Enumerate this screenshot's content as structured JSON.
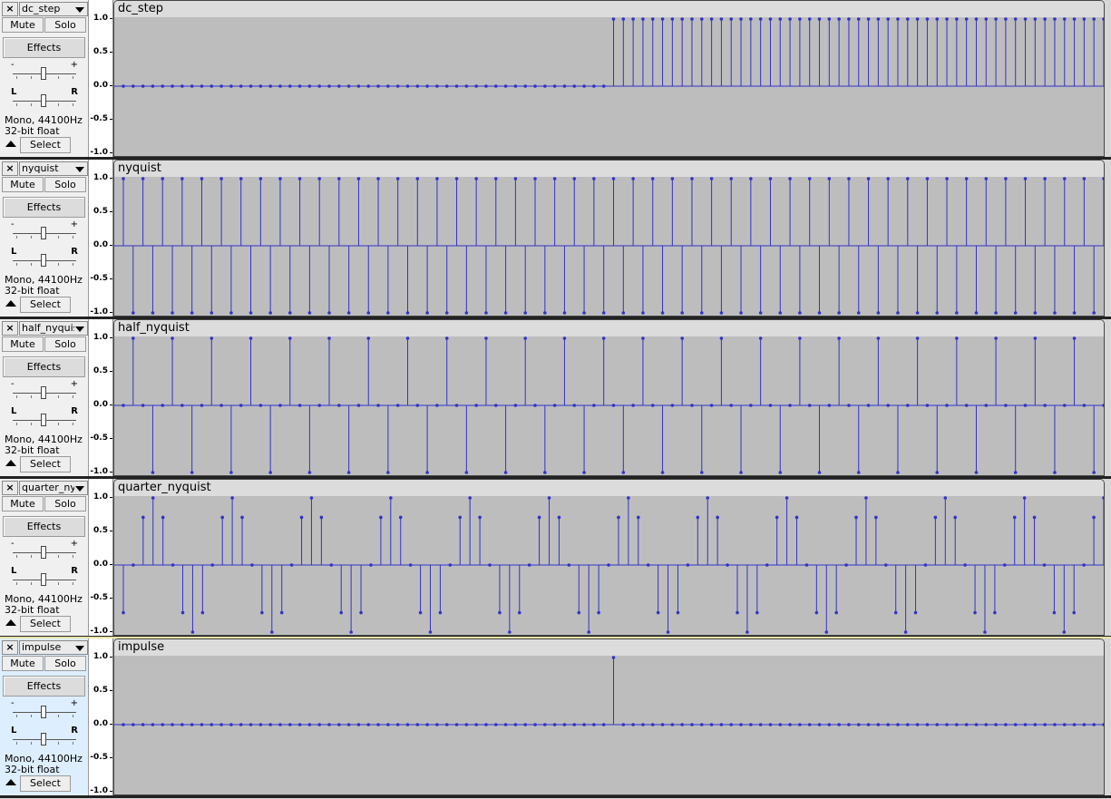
{
  "controls": {
    "close_glyph": "×",
    "mute_label": "Mute",
    "solo_label": "Solo",
    "effects_label": "Effects",
    "select_label": "Select",
    "gain_minus": "-",
    "gain_plus": "+",
    "pan_left": "L",
    "pan_right": "R"
  },
  "colors": {
    "waveform": "#3232c8",
    "background": "#bdbdbd",
    "selected_panel": "#ddeeff"
  },
  "icons": [
    "close-icon",
    "dropdown-chevron-icon",
    "collapse-arrow-icon"
  ],
  "ruler_ticks": [
    "1.0",
    "0.5",
    "0.0",
    "-0.5",
    "-1.0"
  ],
  "tracks": [
    {
      "name": "dc_step",
      "label": "dc_step",
      "format": "Mono, 44100Hz",
      "bit_depth": "32-bit float",
      "selected": false,
      "chart_data": {
        "type": "line",
        "ylim": [
          -1.0,
          1.0
        ],
        "samples": [
          0,
          0,
          0,
          0,
          0,
          0,
          0,
          0,
          0,
          0,
          0,
          0,
          0,
          0,
          0,
          0,
          0,
          0,
          0,
          0,
          0,
          0,
          0,
          0,
          0,
          0,
          0,
          0,
          0,
          0,
          0,
          0,
          0,
          0,
          0,
          0,
          0,
          0,
          0,
          0,
          0,
          0,
          0,
          0,
          0,
          0,
          0,
          0,
          0,
          0,
          1,
          1,
          1,
          1,
          1,
          1,
          1,
          1,
          1,
          1,
          1,
          1,
          1,
          1,
          1,
          1,
          1,
          1,
          1,
          1,
          1,
          1,
          1,
          1,
          1,
          1,
          1,
          1,
          1,
          1,
          1,
          1,
          1,
          1,
          1,
          1,
          1,
          1,
          1,
          1,
          1,
          1,
          1,
          1,
          1,
          1,
          1,
          1,
          1,
          1,
          1
        ]
      }
    },
    {
      "name": "nyquist",
      "label": "nyquist",
      "format": "Mono, 44100Hz",
      "bit_depth": "32-bit float",
      "selected": false,
      "chart_data": {
        "type": "line",
        "ylim": [
          -1.0,
          1.0
        ],
        "samples": [
          1,
          -1,
          1,
          -1,
          1,
          -1,
          1,
          -1,
          1,
          -1,
          1,
          -1,
          1,
          -1,
          1,
          -1,
          1,
          -1,
          1,
          -1,
          1,
          -1,
          1,
          -1,
          1,
          -1,
          1,
          -1,
          1,
          -1,
          1,
          -1,
          1,
          -1,
          1,
          -1,
          1,
          -1,
          1,
          -1,
          1,
          -1,
          1,
          -1,
          1,
          -1,
          1,
          -1,
          1,
          -1,
          1,
          -1,
          1,
          -1,
          1,
          -1,
          1,
          -1,
          1,
          -1,
          1,
          -1,
          1,
          -1,
          1,
          -1,
          1,
          -1,
          1,
          -1,
          1,
          -1,
          1,
          -1,
          1,
          -1,
          1,
          -1,
          1,
          -1,
          1,
          -1,
          1,
          -1,
          1,
          -1,
          1,
          -1,
          1,
          -1,
          1,
          -1,
          1,
          -1,
          1,
          -1,
          1,
          -1,
          1,
          -1,
          1
        ]
      }
    },
    {
      "name": "half_nyquist",
      "label": "half_nyquist",
      "format": "Mono, 44100Hz",
      "bit_depth": "32-bit float",
      "selected": false,
      "chart_data": {
        "type": "line",
        "ylim": [
          -1.0,
          1.0
        ],
        "samples": [
          0,
          1,
          0,
          -1,
          0,
          1,
          0,
          -1,
          0,
          1,
          0,
          -1,
          0,
          1,
          0,
          -1,
          0,
          1,
          0,
          -1,
          0,
          1,
          0,
          -1,
          0,
          1,
          0,
          -1,
          0,
          1,
          0,
          -1,
          0,
          1,
          0,
          -1,
          0,
          1,
          0,
          -1,
          0,
          1,
          0,
          -1,
          0,
          1,
          0,
          -1,
          0,
          1,
          0,
          -1,
          0,
          1,
          0,
          -1,
          0,
          1,
          0,
          -1,
          0,
          1,
          0,
          -1,
          0,
          1,
          0,
          -1,
          0,
          1,
          0,
          -1,
          0,
          1,
          0,
          -1,
          0,
          1,
          0,
          -1,
          0,
          1,
          0,
          -1,
          0,
          1,
          0,
          -1,
          0,
          1,
          0,
          -1,
          0,
          1,
          0,
          -1,
          0,
          1,
          0,
          -1,
          0
        ]
      }
    },
    {
      "name": "quarter_nyquist",
      "label": "quarter_nyquist",
      "format": "Mono, 44100Hz",
      "bit_depth": "32-bit float",
      "selected": false,
      "chart_data": {
        "type": "line",
        "ylim": [
          -1.0,
          1.0
        ],
        "samples": [
          -0.71,
          0,
          0.71,
          1,
          0.71,
          0,
          -0.71,
          -1,
          -0.71,
          0,
          0.71,
          1,
          0.71,
          0,
          -0.71,
          -1,
          -0.71,
          0,
          0.71,
          1,
          0.71,
          0,
          -0.71,
          -1,
          -0.71,
          0,
          0.71,
          1,
          0.71,
          0,
          -0.71,
          -1,
          -0.71,
          0,
          0.71,
          1,
          0.71,
          0,
          -0.71,
          -1,
          -0.71,
          0,
          0.71,
          1,
          0.71,
          0,
          -0.71,
          -1,
          -0.71,
          0,
          0.71,
          1,
          0.71,
          0,
          -0.71,
          -1,
          -0.71,
          0,
          0.71,
          1,
          0.71,
          0,
          -0.71,
          -1,
          -0.71,
          0,
          0.71,
          1,
          0.71,
          0,
          -0.71,
          -1,
          -0.71,
          0,
          0.71,
          1,
          0.71,
          0,
          -0.71,
          -1,
          -0.71,
          0,
          0.71,
          1,
          0.71,
          0,
          -0.71,
          -1,
          -0.71,
          0,
          0.71,
          1,
          0.71,
          0,
          -0.71,
          -1,
          -0.71,
          0,
          0.71,
          1
        ]
      }
    },
    {
      "name": "impulse",
      "label": "impulse",
      "format": "Mono, 44100Hz",
      "bit_depth": "32-bit float",
      "selected": true,
      "chart_data": {
        "type": "line",
        "ylim": [
          -1.0,
          1.0
        ],
        "samples": [
          0,
          0,
          0,
          0,
          0,
          0,
          0,
          0,
          0,
          0,
          0,
          0,
          0,
          0,
          0,
          0,
          0,
          0,
          0,
          0,
          0,
          0,
          0,
          0,
          0,
          0,
          0,
          0,
          0,
          0,
          0,
          0,
          0,
          0,
          0,
          0,
          0,
          0,
          0,
          0,
          0,
          0,
          0,
          0,
          0,
          0,
          0,
          0,
          0,
          0,
          1,
          0,
          0,
          0,
          0,
          0,
          0,
          0,
          0,
          0,
          0,
          0,
          0,
          0,
          0,
          0,
          0,
          0,
          0,
          0,
          0,
          0,
          0,
          0,
          0,
          0,
          0,
          0,
          0,
          0,
          0,
          0,
          0,
          0,
          0,
          0,
          0,
          0,
          0,
          0,
          0,
          0,
          0,
          0,
          0,
          0,
          0,
          0,
          0,
          0,
          0
        ]
      }
    }
  ]
}
